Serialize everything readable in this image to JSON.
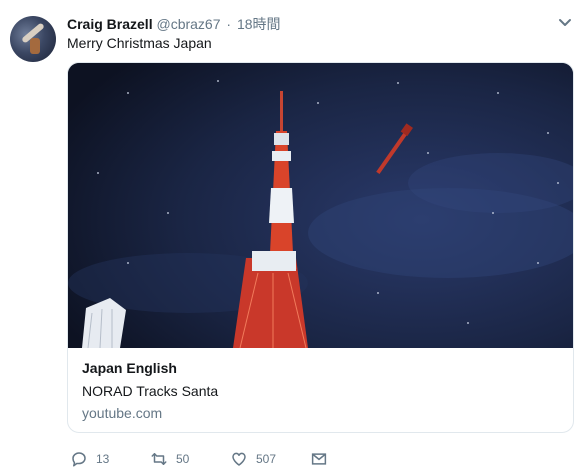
{
  "tweet": {
    "author_name": "Craig Brazell",
    "handle": "@cbraz67",
    "separator": "·",
    "time": "18時間",
    "text": "Merry Christmas Japan"
  },
  "card": {
    "title": "Japan English",
    "description": "NORAD Tracks Santa",
    "domain": "youtube.com"
  },
  "actions": {
    "reply_count": "13",
    "retweet_count": "50",
    "like_count": "507"
  },
  "icons": {
    "reply": "reply-icon",
    "retweet": "retweet-icon",
    "like": "heart-icon",
    "dm": "envelope-icon",
    "caret": "chevron-down-icon"
  },
  "colors": {
    "text_primary": "#14171a",
    "text_secondary": "#657786",
    "border": "#e1e8ed",
    "tower_red": "#d9442a"
  }
}
